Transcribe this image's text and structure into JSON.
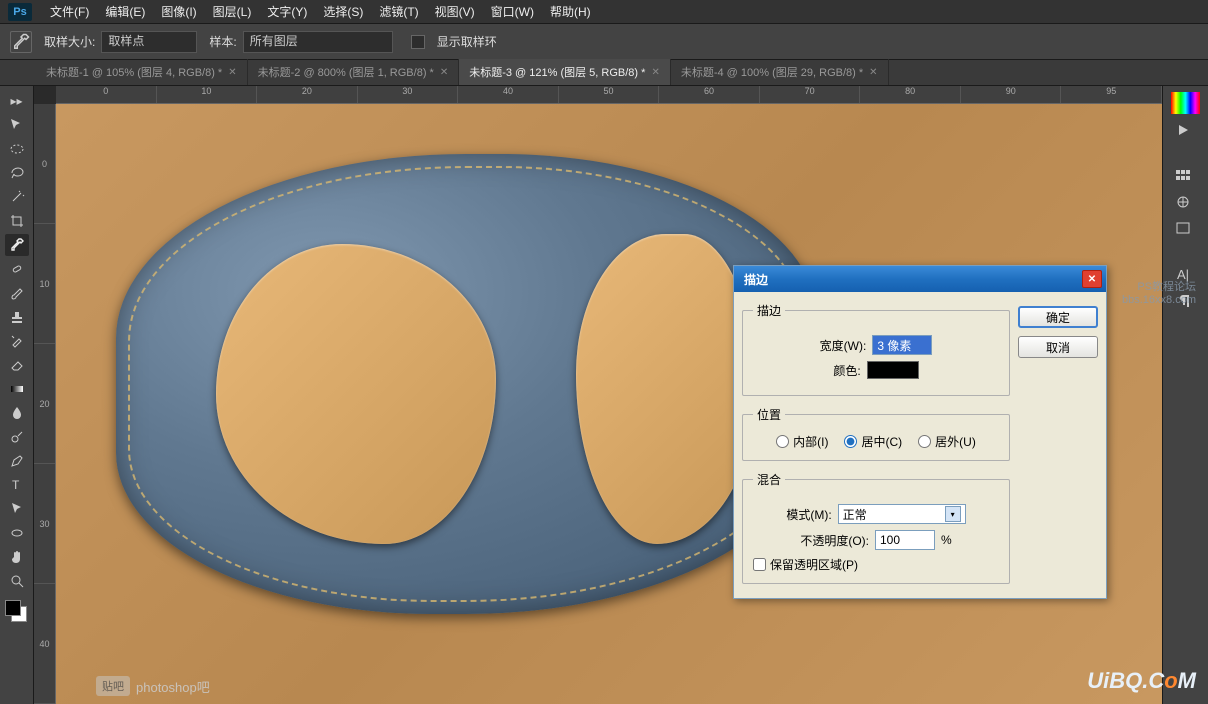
{
  "app": {
    "logo": "Ps"
  },
  "menu": {
    "file": "文件(F)",
    "edit": "编辑(E)",
    "image": "图像(I)",
    "layer": "图层(L)",
    "type": "文字(Y)",
    "select": "选择(S)",
    "filter": "滤镜(T)",
    "view": "视图(V)",
    "window": "窗口(W)",
    "help": "帮助(H)"
  },
  "options": {
    "sample_size_label": "取样大小:",
    "sample_size_value": "取样点",
    "sample_label": "样本:",
    "sample_value": "所有图层",
    "show_ring": "显示取样环"
  },
  "tabs": [
    {
      "label": "未标题-1 @ 105% (图层 4, RGB/8) *",
      "active": false
    },
    {
      "label": "未标题-2 @ 800% (图层 1, RGB/8) *",
      "active": false
    },
    {
      "label": "未标题-3 @ 121% (图层 5, RGB/8) *",
      "active": true
    },
    {
      "label": "未标题-4 @ 100% (图层 29, RGB/8) *",
      "active": false
    }
  ],
  "ruler_h": [
    "0",
    "10",
    "20",
    "30",
    "40",
    "50",
    "60",
    "70",
    "80",
    "90",
    "95"
  ],
  "ruler_v": [
    "0",
    "10",
    "20",
    "30",
    "40"
  ],
  "dialog": {
    "title": "描边",
    "group_stroke": "描边",
    "width_label": "宽度(W):",
    "width_value": "3 像素",
    "color_label": "颜色:",
    "group_position": "位置",
    "pos_inside": "内部(I)",
    "pos_center": "居中(C)",
    "pos_outside": "居外(U)",
    "group_blend": "混合",
    "mode_label": "模式(M):",
    "mode_value": "正常",
    "opacity_label": "不透明度(O):",
    "opacity_value": "100",
    "opacity_unit": "%",
    "preserve": "保留透明区域(P)",
    "ok": "确定",
    "cancel": "取消"
  },
  "watermark": {
    "forum1": "PS教程论坛",
    "forum2": "bbs.16xx8.com",
    "site": "UiBQ.C",
    "site_o": "o",
    "site_m": "M",
    "baidu": "贴吧",
    "psbar": "photoshop吧"
  }
}
